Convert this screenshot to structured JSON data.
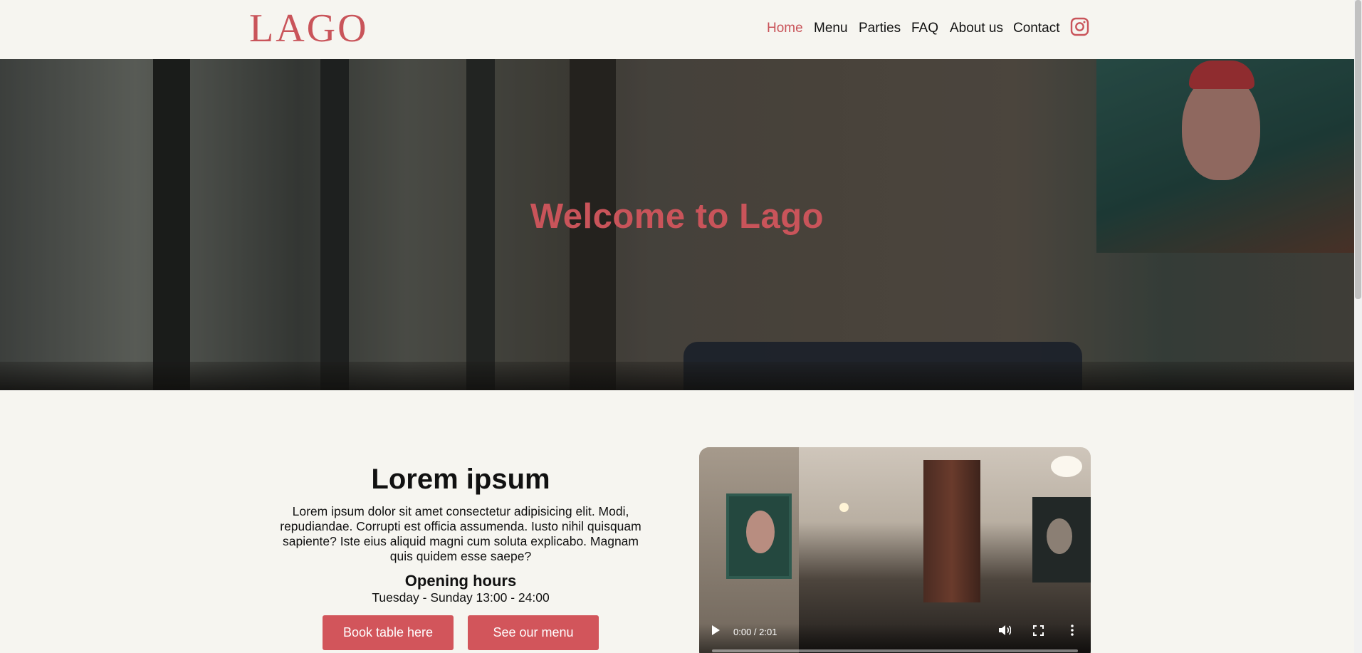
{
  "header": {
    "logo": "LAGO",
    "nav": [
      {
        "label": "Home",
        "active": true
      },
      {
        "label": "Menu",
        "active": false
      },
      {
        "label": "Parties",
        "active": false
      },
      {
        "label": "FAQ",
        "active": false
      },
      {
        "label": "About us",
        "active": false
      },
      {
        "label": "Contact",
        "active": false
      }
    ],
    "social_icon": "instagram-icon"
  },
  "hero": {
    "title": "Welcome to Lago"
  },
  "intro": {
    "heading": "Lorem ipsum",
    "body": "Lorem ipsum dolor sit amet consectetur adipisicing elit. Modi, repudiandae. Corrupti est officia assumenda. Iusto nihil quisquam sapiente? Iste eius aliquid magni cum soluta explicabo. Magnam quis quidem esse saepe?",
    "hours_heading": "Opening hours",
    "hours": "Tuesday - Sunday 13:00 - 24:00",
    "book_button": "Book table here",
    "menu_button": "See our menu"
  },
  "video": {
    "time": "0:00 / 2:01",
    "progress": 0
  },
  "colors": {
    "accent": "#c9545a",
    "button": "#d2555b",
    "background": "#f6f5f0"
  }
}
